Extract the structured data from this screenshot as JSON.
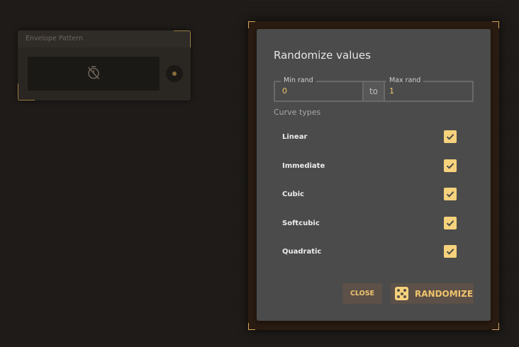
{
  "node": {
    "title": "Envelope Pattern",
    "icon": "timer-off-icon"
  },
  "dialog": {
    "title": "Randomize values",
    "min_label": "Min rand",
    "min_value": "0",
    "to_label": "to",
    "max_label": "Max rand",
    "max_value": "1",
    "curve_types_label": "Curve types",
    "curves": [
      {
        "label": "Linear",
        "checked": true
      },
      {
        "label": "Immediate",
        "checked": true
      },
      {
        "label": "Cubic",
        "checked": true
      },
      {
        "label": "Softcubic",
        "checked": true
      },
      {
        "label": "Quadratic",
        "checked": true
      }
    ],
    "close_label": "CLOSE",
    "randomize_label": "RANDOMIZE"
  },
  "colors": {
    "accent": "#f0c46c",
    "checkbox": "#f6d27c",
    "dialog_bg": "#4b4b4b",
    "frame_corner": "#d6a659"
  }
}
